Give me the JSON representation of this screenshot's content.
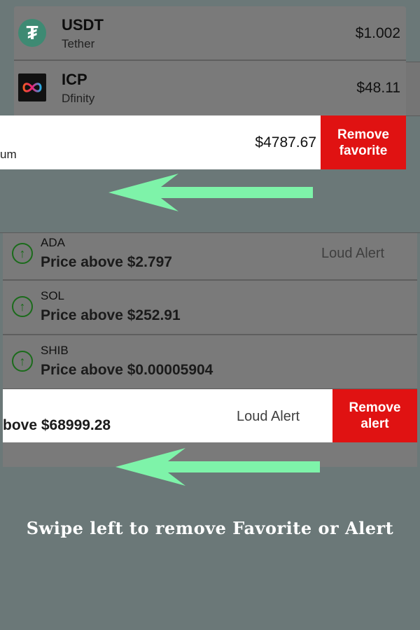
{
  "favorites": {
    "items": [
      {
        "symbol": "USDT",
        "name": "Tether",
        "price": "$1.002",
        "logo": "tether-logo"
      },
      {
        "symbol": "ICP",
        "name": "Dfinity",
        "price": "$48.11",
        "logo": "dfinity-logo"
      }
    ],
    "swiped": {
      "name_fragment": "um",
      "price": "$4787.67"
    },
    "remove_label_1": "Remove",
    "remove_label_2": "favorite"
  },
  "alerts": {
    "items": [
      {
        "symbol": "ADA",
        "condition": "Price above $2.797",
        "type": "Loud Alert",
        "icon": "arrow-up-circle-icon"
      },
      {
        "symbol": "SOL",
        "condition": "Price above $252.91",
        "icon": "arrow-up-circle-icon"
      },
      {
        "symbol": "SHIB",
        "condition": "Price above $0.00005904",
        "icon": "arrow-up-circle-icon"
      }
    ],
    "swiped": {
      "condition_fragment": "bove $68999.28",
      "type": "Loud Alert"
    },
    "remove_label_1": "Remove",
    "remove_label_2": "alert"
  },
  "caption": "Swipe left to remove Favorite or Alert",
  "colors": {
    "background": "#6b7878",
    "remove_button": "#e01212",
    "swipe_arrow": "#7ef3a9",
    "alert_icon": "#1b6b1b",
    "tether_brand": "#3e8a73"
  }
}
